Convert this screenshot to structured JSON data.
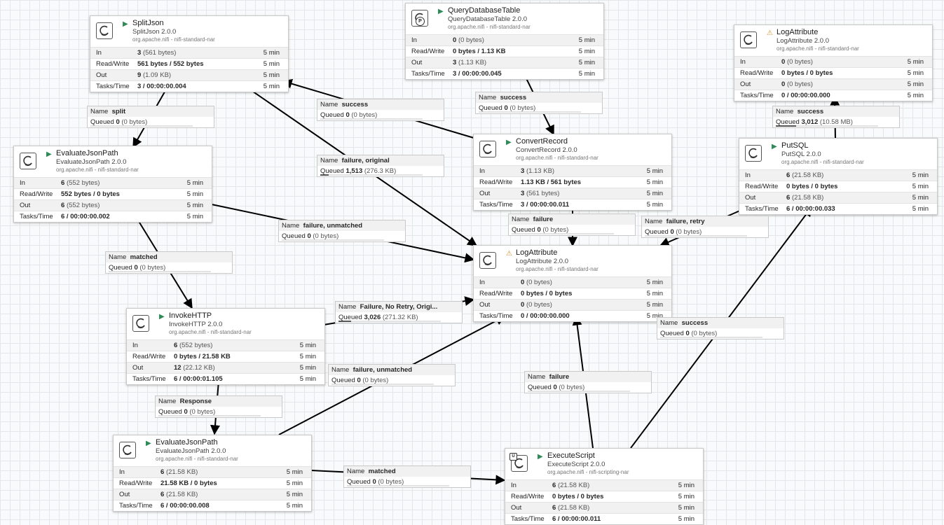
{
  "labels": {
    "in": "In",
    "rw": "Read/Write",
    "out": "Out",
    "tasks": "Tasks/Time",
    "name": "Name",
    "queued": "Queued"
  },
  "icons": {
    "processor": "processor-icon",
    "running": "play-icon",
    "warning": "warning-icon",
    "primary_node": "primary-node-icon",
    "scripted": "script-icon"
  },
  "colors": {
    "running": "#2e8b57",
    "warning": "#d9902a",
    "canvas": "#f9fafb"
  },
  "processors": [
    {
      "id": "splitjson",
      "name": "SplitJson",
      "type": "SplitJson 2.0.0",
      "bundle": "org.apache.nifi - nifi-standard-nar",
      "state": "running",
      "stats": {
        "in": "3",
        "in_sub": "(561 bytes)",
        "in_t": "5 min",
        "rw": "561 bytes / 552 bytes",
        "rw_t": "5 min",
        "out": "9",
        "out_sub": "(1.09 KB)",
        "out_t": "5 min",
        "tasks": "3 / 00:00:00.004",
        "tasks_t": "5 min"
      }
    },
    {
      "id": "qdt",
      "name": "QueryDatabaseTable",
      "type": "QueryDatabaseTable 2.0.0",
      "bundle": "org.apache.nifi - nifi-standard-nar",
      "state": "running",
      "badge": "P",
      "stats": {
        "in": "0",
        "in_sub": "(0 bytes)",
        "in_t": "5 min",
        "rw": "0 bytes / 1.13 KB",
        "rw_t": "5 min",
        "out": "3",
        "out_sub": "(1.13 KB)",
        "out_t": "5 min",
        "tasks": "3 / 00:00:00.045",
        "tasks_t": "5 min"
      }
    },
    {
      "id": "logattr_top",
      "name": "LogAttribute",
      "type": "LogAttribute 2.0.0",
      "bundle": "org.apache.nifi - nifi-standard-nar",
      "state": "warning",
      "stats": {
        "in": "0",
        "in_sub": "(0 bytes)",
        "in_t": "5 min",
        "rw": "0 bytes / 0 bytes",
        "rw_t": "5 min",
        "out": "0",
        "out_sub": "(0 bytes)",
        "out_t": "5 min",
        "tasks": "0 / 00:00:00.000",
        "tasks_t": "5 min"
      }
    },
    {
      "id": "ejp1",
      "name": "EvaluateJsonPath",
      "type": "EvaluateJsonPath 2.0.0",
      "bundle": "org.apache.nifi - nifi-standard-nar",
      "state": "running",
      "stats": {
        "in": "6",
        "in_sub": "(552 bytes)",
        "in_t": "5 min",
        "rw": "552 bytes / 0 bytes",
        "rw_t": "5 min",
        "out": "6",
        "out_sub": "(552 bytes)",
        "out_t": "5 min",
        "tasks": "6 / 00:00:00.002",
        "tasks_t": "5 min"
      }
    },
    {
      "id": "convert",
      "name": "ConvertRecord",
      "type": "ConvertRecord 2.0.0",
      "bundle": "org.apache.nifi - nifi-standard-nar",
      "state": "running",
      "stats": {
        "in": "3",
        "in_sub": "(1.13 KB)",
        "in_t": "5 min",
        "rw": "1.13 KB / 561 bytes",
        "rw_t": "5 min",
        "out": "3",
        "out_sub": "(561 bytes)",
        "out_t": "5 min",
        "tasks": "3 / 00:00:00.011",
        "tasks_t": "5 min"
      }
    },
    {
      "id": "putsql",
      "name": "PutSQL",
      "type": "PutSQL 2.0.0",
      "bundle": "org.apache.nifi - nifi-standard-nar",
      "state": "running",
      "stats": {
        "in": "6",
        "in_sub": "(21.58 KB)",
        "in_t": "5 min",
        "rw": "0 bytes / 0 bytes",
        "rw_t": "5 min",
        "out": "6",
        "out_sub": "(21.58 KB)",
        "out_t": "5 min",
        "tasks": "6 / 00:00:00.033",
        "tasks_t": "5 min"
      }
    },
    {
      "id": "logattr_mid",
      "name": "LogAttribute",
      "type": "LogAttribute 2.0.0",
      "bundle": "org.apache.nifi - nifi-standard-nar",
      "state": "warning",
      "stats": {
        "in": "0",
        "in_sub": "(0 bytes)",
        "in_t": "5 min",
        "rw": "0 bytes / 0 bytes",
        "rw_t": "5 min",
        "out": "0",
        "out_sub": "(0 bytes)",
        "out_t": "5 min",
        "tasks": "0 / 00:00:00.000",
        "tasks_t": "5 min"
      }
    },
    {
      "id": "invokehttp",
      "name": "InvokeHTTP",
      "type": "InvokeHTTP 2.0.0",
      "bundle": "org.apache.nifi - nifi-standard-nar",
      "state": "running",
      "stats": {
        "in": "6",
        "in_sub": "(552 bytes)",
        "in_t": "5 min",
        "rw": "0 bytes / 21.58 KB",
        "rw_t": "5 min",
        "out": "12",
        "out_sub": "(22.12 KB)",
        "out_t": "5 min",
        "tasks": "6 / 00:00:01.105",
        "tasks_t": "5 min"
      }
    },
    {
      "id": "ejp2",
      "name": "EvaluateJsonPath",
      "type": "EvaluateJsonPath 2.0.0",
      "bundle": "org.apache.nifi - nifi-standard-nar",
      "state": "running",
      "stats": {
        "in": "6",
        "in_sub": "(21.58 KB)",
        "in_t": "5 min",
        "rw": "21.58 KB / 0 bytes",
        "rw_t": "5 min",
        "out": "6",
        "out_sub": "(21.58 KB)",
        "out_t": "5 min",
        "tasks": "6 / 00:00:00.008",
        "tasks_t": "5 min"
      }
    },
    {
      "id": "execscript",
      "name": "ExecuteScript",
      "type": "ExecuteScript 2.0.0",
      "bundle": "org.apache.nifi - nifi-scripting-nar",
      "state": "running",
      "scripted": true,
      "stats": {
        "in": "6",
        "in_sub": "(21.58 KB)",
        "in_t": "5 min",
        "rw": "0 bytes / 0 bytes",
        "rw_t": "5 min",
        "out": "6",
        "out_sub": "(21.58 KB)",
        "out_t": "5 min",
        "tasks": "6 / 00:00:00.011",
        "tasks_t": "5 min"
      }
    }
  ],
  "connections": [
    {
      "id": "c_split",
      "name": "split",
      "queued": "0",
      "queued_sub": "(0 bytes)",
      "fill": 0
    },
    {
      "id": "c_qdt_success",
      "name": "success",
      "queued": "0",
      "queued_sub": "(0 bytes)",
      "fill": 0
    },
    {
      "id": "c_conv_success",
      "name": "success",
      "queued": "0",
      "queued_sub": "(0 bytes)",
      "fill": 0
    },
    {
      "id": "c_put_success",
      "name": "success",
      "queued": "3,012",
      "queued_sub": "(10.58 MB)",
      "fill": 0.2
    },
    {
      "id": "c_fail_orig",
      "name": "failure, original",
      "queued": "1,513",
      "queued_sub": "(276.3 KB)",
      "fill": 0.08
    },
    {
      "id": "c_conv_fail",
      "name": "failure",
      "queued": "0",
      "queued_sub": "(0 bytes)",
      "fill": 0
    },
    {
      "id": "c_fail_retry",
      "name": "failure, retry",
      "queued": "0",
      "queued_sub": "(0 bytes)",
      "fill": 0
    },
    {
      "id": "c_fail_unm1",
      "name": "failure, unmatched",
      "queued": "0",
      "queued_sub": "(0 bytes)",
      "fill": 0
    },
    {
      "id": "c_matched1",
      "name": "matched",
      "queued": "0",
      "queued_sub": "(0 bytes)",
      "fill": 0
    },
    {
      "id": "c_fail_noretry",
      "name": "Failure, No Retry, Origi...",
      "queued": "3,026",
      "queued_sub": "(271.32 KB)",
      "fill": 0.12
    },
    {
      "id": "c_exec_success",
      "name": "success",
      "queued": "0",
      "queued_sub": "(0 bytes)",
      "fill": 0
    },
    {
      "id": "c_fail_unm2",
      "name": "failure, unmatched",
      "queued": "0",
      "queued_sub": "(0 bytes)",
      "fill": 0
    },
    {
      "id": "c_exec_fail",
      "name": "failure",
      "queued": "0",
      "queued_sub": "(0 bytes)",
      "fill": 0
    },
    {
      "id": "c_response",
      "name": "Response",
      "queued": "0",
      "queued_sub": "(0 bytes)",
      "fill": 0
    },
    {
      "id": "c_matched2",
      "name": "matched",
      "queued": "0",
      "queued_sub": "(0 bytes)",
      "fill": 0
    }
  ]
}
